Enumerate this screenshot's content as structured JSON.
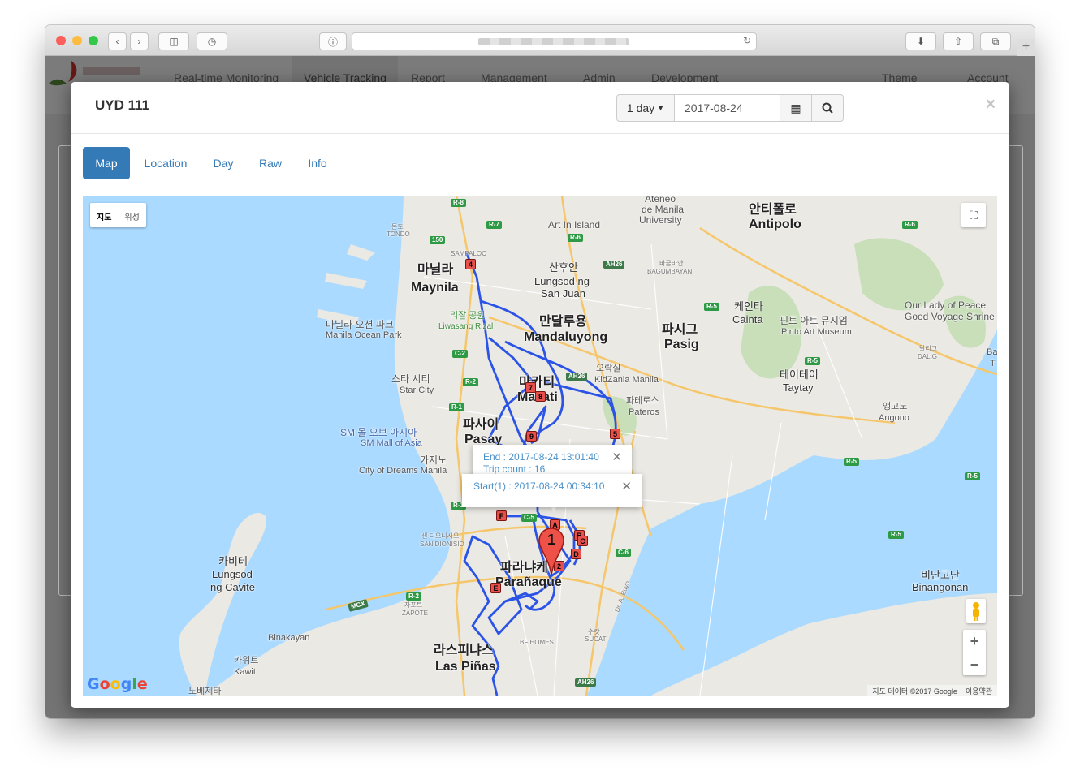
{
  "browser": {
    "traffic_lights": [
      "#fc605c",
      "#fdbc40",
      "#34c84a"
    ],
    "add_tab": "+"
  },
  "app": {
    "nav": [
      {
        "label": "Real-time Monitoring"
      },
      {
        "label": "Vehicle Tracking"
      },
      {
        "label": "Report"
      },
      {
        "label": "Management"
      },
      {
        "label": "Admin"
      },
      {
        "label": "Development"
      },
      {
        "label": "Theme"
      },
      {
        "label": "Account"
      }
    ],
    "active_nav": "Vehicle Tracking",
    "brand_color": "#c9302c"
  },
  "modal": {
    "title": "UYD 111",
    "range_label": "1 day",
    "date_value": "2017-08-24",
    "close": "×",
    "tabs": [
      {
        "label": "Map"
      },
      {
        "label": "Location"
      },
      {
        "label": "Day"
      },
      {
        "label": "Raw"
      },
      {
        "label": "Info"
      }
    ],
    "active_tab": "Map",
    "accent": "#337ab7"
  },
  "map": {
    "toggle_map": "지도",
    "toggle_satellite": "위성",
    "zoom_in": "+",
    "zoom_out": "−",
    "logo": "Google",
    "attribution": "지도 데이터 ©2017 Google",
    "terms": "이용약관",
    "route_color": "#2b54e6",
    "water_color": "#aadaff",
    "land_color": "#ebe9e4",
    "park_color": "#c8dfb9",
    "info_end": {
      "line1": "End : 2017-08-24 13:01:40",
      "line2": "Trip count : 16"
    },
    "info_start": {
      "line1": "Start(1) : 2017-08-24 00:34:10"
    },
    "big_marker": "1",
    "markers": [
      "4",
      "7",
      "8",
      "9",
      "5",
      "F",
      "A",
      "B",
      "C",
      "D",
      "2",
      "E"
    ],
    "places": {
      "manila_ko": "마닐라",
      "manila": "Maynila",
      "mandaluyong_ko": "만달루용",
      "mandaluyong": "Mandaluyong",
      "pasig_ko": "파시그",
      "pasig": "Pasig",
      "makati_ko": "마카티",
      "makati": "Makati",
      "pasay_ko": "파사이",
      "pasay": "Pasay",
      "paranaque_ko": "파라냐케",
      "paranaque": "Parañaque",
      "laspinas_ko": "라스피냐스",
      "laspinas": "Las Piñas",
      "antipolo_ko": "안티폴로",
      "antipolo": "Antipolo",
      "cainta_ko": "케인타",
      "cainta": "Cainta",
      "taytay_ko": "테이테이",
      "taytay": "Taytay",
      "pateros_ko": "파테로스",
      "pateros": "Pateros",
      "angono_ko": "앵고노",
      "angono": "Angono",
      "binangonan_ko": "비난고난",
      "binangonan": "Binangonan",
      "cavite_ko": "카비테",
      "cavite1": "Lungsod",
      "cavite2": "ng Cavite",
      "kawit_ko": "카위트",
      "kawit": "Kawit",
      "binakayan": "Binakayan",
      "sanjuan1": "Lungsod ng",
      "sanjuan2": "San Juan",
      "sanjuan_ko": "산후안",
      "ateneo1": "Ateneo",
      "ateneo2": "de Manila",
      "ateneo3": "University",
      "artinisland": "Art In Island",
      "oceanpark_ko": "마닐라 오션 파크",
      "oceanpark": "Manila Ocean Park",
      "rizal_ko": "리잘 공원",
      "rizal": "Liwasang Rizal",
      "starcity_ko": "스타 시티",
      "starcity": "Star City",
      "smmall_ko": "SM 몰 오브 아시아",
      "smmall": "SM Mall of Asia",
      "cod_ko": "카지노",
      "cod": "City of Dreams Manila",
      "kidzania_ko": "오락실",
      "kidzania": "KidZania Manila",
      "pinto_ko": "핀토 아트 뮤지엄",
      "pinto": "Pinto Art Museum",
      "ourlady1": "Our Lady of Peace",
      "ourlady2": "Good Voyage Shrine",
      "bagumbayan": "BAGUMBAYAN",
      "bagumbayan_ko": "바굼바얀",
      "sampaloc": "SAMPALOC",
      "tondo": "TONDO",
      "tondo_ko": "톤도",
      "sandionisio": "SAN DIONISIO",
      "sandionisio_ko": "샌 디오니시오",
      "zapote": "ZAPOTE",
      "zapote_ko": "자포트",
      "bfhomes": "BF HOMES",
      "sucat": "SUCAT",
      "sucat_ko": "수캇",
      "dalig": "DALIG",
      "dalig_ko": "달리그",
      "dralbuyo": "Dr. A. Buyo",
      "ba": "Ba",
      "t": "T",
      "bottomcut": "노베제타"
    },
    "shields": [
      "R-8",
      "R-7",
      "R-6",
      "150",
      "AH26",
      "R-5",
      "R-6",
      "C-2",
      "R-2",
      "R-1",
      "AH26",
      "R-5",
      "R-5",
      "C-6",
      "R-2",
      "MCX",
      "AH26",
      "R-5",
      "R-5",
      "R-1",
      "C-5"
    ]
  }
}
